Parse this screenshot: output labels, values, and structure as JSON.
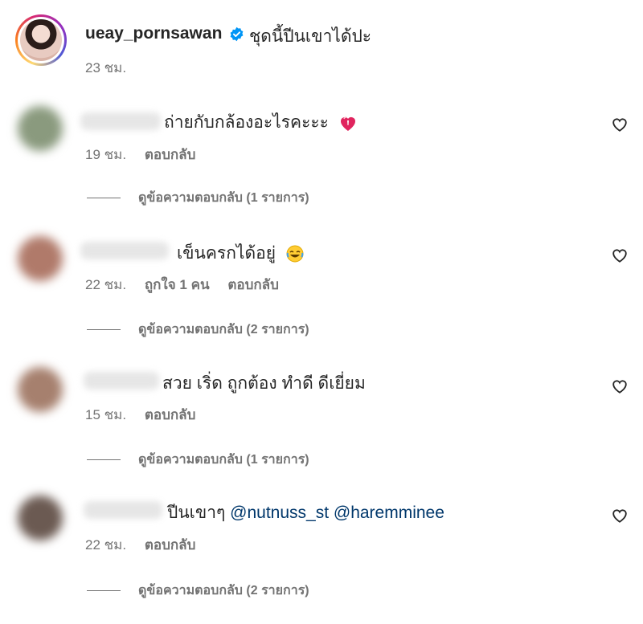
{
  "post": {
    "username": "ueay_pornsawan",
    "caption": "ชุดนี้ปีนเขาได้ปะ",
    "time": "23 ชม."
  },
  "comments": [
    {
      "text": "ถ่ายกับกล้องอะไรคะะะ",
      "emoji": "heart-exclamation",
      "time": "19 ชม.",
      "likes": "",
      "reply": "ตอบกลับ",
      "view_replies": "ดูข้อความตอบกลับ (1 รายการ)",
      "avatar_color": "#8a9a7e"
    },
    {
      "text": "เข็นครกได้อยู่",
      "emoji": "face-with-tears-of-joy",
      "time": "22 ชม.",
      "likes": "ถูกใจ 1 คน",
      "reply": "ตอบกลับ",
      "view_replies": "ดูข้อความตอบกลับ (2 รายการ)",
      "avatar_color": "#b07a6a"
    },
    {
      "text": "สวย เริ่ด ถูกต้อง ทำดี ดีเยี่ยม",
      "emoji": "",
      "time": "15 ชม.",
      "likes": "",
      "reply": "ตอบกลับ",
      "view_replies": "ดูข้อความตอบกลับ (1 รายการ)",
      "avatar_color": "#a6806e"
    },
    {
      "text": "ปีนเขาๆ",
      "mention1": "@nutnuss_st",
      "mention2": "@haremminee",
      "emoji": "",
      "time": "22 ชม.",
      "likes": "",
      "reply": "ตอบกลับ",
      "view_replies": "ดูข้อความตอบกลับ (2 รายการ)",
      "avatar_color": "#6b5a52"
    }
  ],
  "colors": {
    "text": "#262626",
    "secondary": "#737373",
    "mention": "#00376b",
    "verified": "#0095f6"
  }
}
